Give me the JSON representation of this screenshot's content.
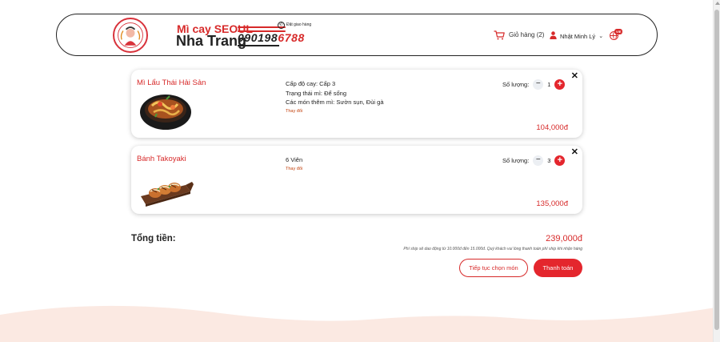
{
  "header": {
    "brand_line1": "Mì cay SEOUL",
    "brand_line2": "Nha Trang",
    "order_label": "Đặt giao hàng",
    "phone_part1": "090198",
    "phone_part2": "6788",
    "cart_label": "Giỏ hàng (2)",
    "user_name": "Nhật Minh Lý",
    "language_badge": "VIE"
  },
  "cart": {
    "items": [
      {
        "name": "Mì Lẩu Thái Hải Sản",
        "options": [
          "Cấp độ cay: Cấp 3",
          "Trạng thái mì: Để sống",
          "Các món thêm mì: Sườn sụn, Đùi gà"
        ],
        "change_label": "Thay đổi",
        "quantity_label": "Số lượng:",
        "quantity": "1",
        "price": "104,000đ"
      },
      {
        "name": "Bánh Takoyaki",
        "options": [
          "6 Viên"
        ],
        "change_label": "Thay đổi",
        "quantity_label": "Số lượng:",
        "quantity": "3",
        "price": "135,000đ"
      }
    ]
  },
  "summary": {
    "total_label": "Tổng tiền:",
    "total_value": "239,000đ",
    "shipping_note": "Phí ship sẽ dao động từ 10.000đ đến 15.000đ. Quý khách vui lòng thanh toán phí ship khi nhận hàng",
    "continue_label": "Tiếp tục chọn món",
    "pay_label": "Thanh toán"
  },
  "colors": {
    "accent": "#e4262d",
    "brand_red": "#d72a2a",
    "wave": "#fbe9e2"
  },
  "icons": [
    "phone-icon",
    "cart-icon",
    "user-icon",
    "chevron-down-icon",
    "globe-icon",
    "close-icon",
    "minus-icon",
    "plus-icon"
  ]
}
